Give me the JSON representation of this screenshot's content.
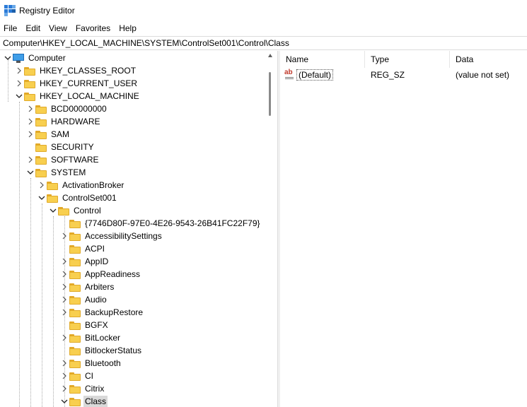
{
  "window": {
    "title": "Registry Editor"
  },
  "menu": [
    "File",
    "Edit",
    "View",
    "Favorites",
    "Help"
  ],
  "address": {
    "value": "Computer\\HKEY_LOCAL_MACHINE\\SYSTEM\\ControlSet001\\Control\\Class"
  },
  "tree": {
    "nodes": [
      {
        "label": "Computer",
        "state": "expanded",
        "icon": "computer-icon"
      },
      {
        "label": "HKEY_CLASSES_ROOT",
        "state": "collapsed",
        "icon": "folder-icon"
      },
      {
        "label": "HKEY_CURRENT_USER",
        "state": "collapsed",
        "icon": "folder-icon"
      },
      {
        "label": "HKEY_LOCAL_MACHINE",
        "state": "expanded",
        "icon": "folder-icon"
      },
      {
        "label": "BCD00000000",
        "state": "collapsed",
        "icon": "folder-icon"
      },
      {
        "label": "HARDWARE",
        "state": "collapsed",
        "icon": "folder-icon"
      },
      {
        "label": "SAM",
        "state": "collapsed",
        "icon": "folder-icon"
      },
      {
        "label": "SECURITY",
        "state": "none",
        "icon": "folder-icon"
      },
      {
        "label": "SOFTWARE",
        "state": "collapsed",
        "icon": "folder-icon"
      },
      {
        "label": "SYSTEM",
        "state": "expanded",
        "icon": "folder-icon"
      },
      {
        "label": "ActivationBroker",
        "state": "collapsed",
        "icon": "folder-icon"
      },
      {
        "label": "ControlSet001",
        "state": "expanded",
        "icon": "folder-icon"
      },
      {
        "label": "Control",
        "state": "expanded",
        "icon": "folder-icon"
      },
      {
        "label": "{7746D80F-97E0-4E26-9543-26B41FC22F79}",
        "state": "none",
        "icon": "folder-icon"
      },
      {
        "label": "AccessibilitySettings",
        "state": "collapsed",
        "icon": "folder-icon"
      },
      {
        "label": "ACPI",
        "state": "none",
        "icon": "folder-icon"
      },
      {
        "label": "AppID",
        "state": "collapsed",
        "icon": "folder-icon"
      },
      {
        "label": "AppReadiness",
        "state": "collapsed",
        "icon": "folder-icon"
      },
      {
        "label": "Arbiters",
        "state": "collapsed",
        "icon": "folder-icon"
      },
      {
        "label": "Audio",
        "state": "collapsed",
        "icon": "folder-icon"
      },
      {
        "label": "BackupRestore",
        "state": "collapsed",
        "icon": "folder-icon"
      },
      {
        "label": "BGFX",
        "state": "none",
        "icon": "folder-icon"
      },
      {
        "label": "BitLocker",
        "state": "collapsed",
        "icon": "folder-icon"
      },
      {
        "label": "BitlockerStatus",
        "state": "none",
        "icon": "folder-icon"
      },
      {
        "label": "Bluetooth",
        "state": "collapsed",
        "icon": "folder-icon"
      },
      {
        "label": "CI",
        "state": "collapsed",
        "icon": "folder-icon"
      },
      {
        "label": "Citrix",
        "state": "collapsed",
        "icon": "folder-icon"
      },
      {
        "label": "Class",
        "state": "expanded",
        "icon": "folder-icon",
        "selected": true
      }
    ]
  },
  "values": {
    "columns": [
      "Name",
      "Type",
      "Data"
    ],
    "rows": [
      {
        "name": "(Default)",
        "type": "REG_SZ",
        "data": "(value not set)",
        "icon": "string-value-icon"
      }
    ]
  },
  "colors": {
    "selection": "#d9d9d9",
    "folder": "#f8cf4f",
    "accent": "#2b7bd8"
  }
}
